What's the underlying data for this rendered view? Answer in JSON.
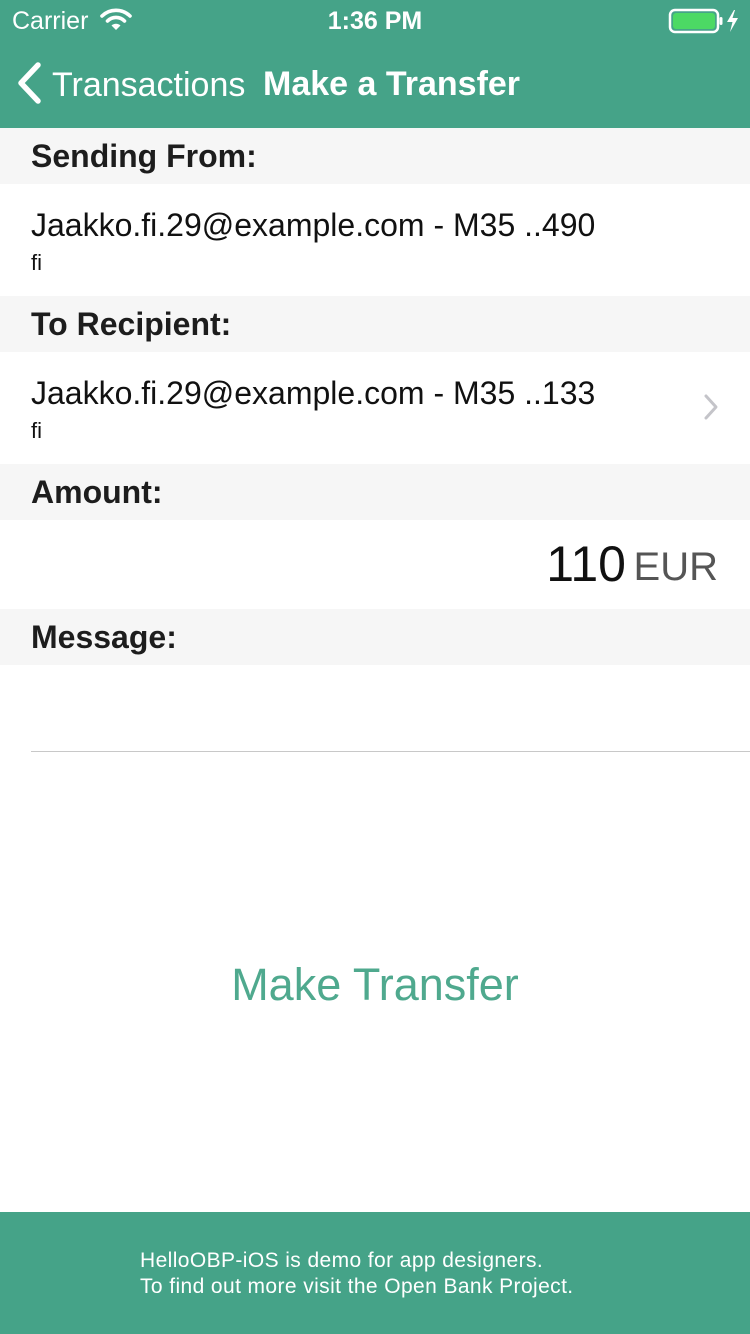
{
  "status_bar": {
    "carrier": "Carrier",
    "time": "1:36 PM",
    "battery_color": "#4cd964"
  },
  "nav": {
    "back_label": "Transactions",
    "title": "Make a Transfer",
    "bar_color": "#45a388"
  },
  "sending_from": {
    "header": "Sending From:",
    "account": "Jaakko.fi.29@example.com - M35 ..490",
    "bank": "fi"
  },
  "to_recipient": {
    "header": "To Recipient:",
    "account": "Jaakko.fi.29@example.com - M35 ..133",
    "bank": "fi"
  },
  "amount": {
    "header": "Amount:",
    "value": "110",
    "currency": "EUR"
  },
  "message": {
    "header": "Message:",
    "value": ""
  },
  "action": {
    "label": "Make Transfer",
    "color": "#4fa98e"
  },
  "footer": {
    "line1": "HelloOBP-iOS is demo for app designers.",
    "line2": "To find out more visit the Open Bank Project."
  }
}
